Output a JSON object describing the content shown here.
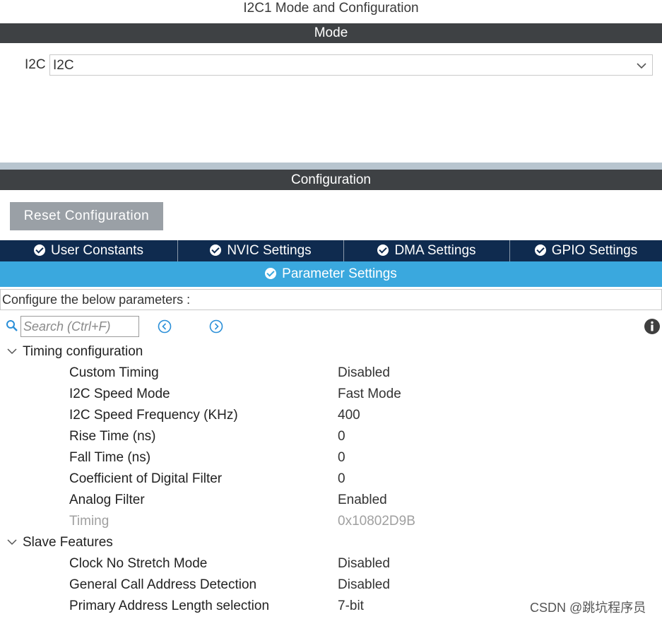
{
  "window": {
    "title": "I2C1 Mode and Configuration"
  },
  "mode": {
    "header": "Mode",
    "field_label": "I2C",
    "field_value": "I2C"
  },
  "configuration": {
    "header": "Configuration",
    "reset_button": "Reset Configuration",
    "tabs": [
      {
        "label": "User Constants"
      },
      {
        "label": "NVIC Settings"
      },
      {
        "label": "DMA Settings"
      },
      {
        "label": "GPIO Settings"
      }
    ],
    "active_tab": {
      "label": "Parameter Settings"
    },
    "description": "Configure the below parameters :",
    "search": {
      "placeholder": "Search (Ctrl+F)"
    }
  },
  "groups": [
    {
      "title": "Timing configuration",
      "rows": [
        {
          "name": "Custom Timing",
          "value": "Disabled"
        },
        {
          "name": "I2C Speed Mode",
          "value": "Fast Mode"
        },
        {
          "name": "I2C Speed Frequency (KHz)",
          "value": "400"
        },
        {
          "name": "Rise Time (ns)",
          "value": "0"
        },
        {
          "name": "Fall Time (ns)",
          "value": "0"
        },
        {
          "name": "Coefficient of Digital Filter",
          "value": "0"
        },
        {
          "name": "Analog Filter",
          "value": "Enabled"
        },
        {
          "name": "Timing",
          "value": "0x10802D9B"
        }
      ]
    },
    {
      "title": "Slave Features",
      "rows": [
        {
          "name": "Clock No Stretch Mode",
          "value": "Disabled"
        },
        {
          "name": "General Call Address Detection",
          "value": "Disabled"
        },
        {
          "name": "Primary Address Length selection",
          "value": "7-bit"
        }
      ]
    }
  ],
  "watermark": "CSDN @跳坑程序员",
  "colors": {
    "header_bar": "#3e4144",
    "tab_bar": "#0f2b4f",
    "active_tab": "#3aa8de",
    "reset_button": "#9aa0a6",
    "separator": "#b8c5cf"
  },
  "icons": [
    "chevron-down-icon",
    "check-circle-icon",
    "search-icon",
    "arrow-left-circle-icon",
    "arrow-right-circle-icon",
    "info-icon",
    "collapse-chevron-icon"
  ]
}
